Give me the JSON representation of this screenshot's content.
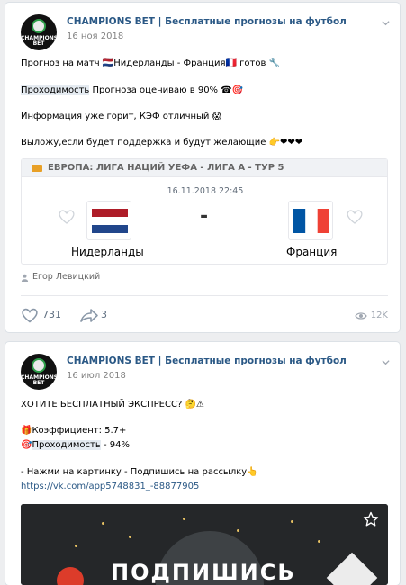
{
  "posts": [
    {
      "author": "CHAMPIONS BET | Бесплатные прогнозы на футбол",
      "avatar_text": "CHAMPIONS BET",
      "date": "16 ноя 2018",
      "lines": [
        {
          "pre": "Прогноз на матч ",
          "mid": "Нидерланды - Франция",
          "post": " готов"
        },
        {
          "hl": "Проходимость",
          "text": " Прогноза оцениваю в 90% "
        },
        {
          "text": "Информация уже горит, КЭФ отличный "
        },
        {
          "text": "Выложу,если будет поддержка и будут желающие "
        }
      ],
      "emojis": {
        "nl_flag": "🇳🇱",
        "fr_flag": "🇫🇷",
        "tools": "🔧",
        "phone": "☎🎯",
        "scream": "😱",
        "hearts": "👉❤❤❤"
      },
      "match_card": {
        "league": "ЕВРОПА: ЛИГА НАЦИЙ УЕФА - ЛИГА А - ТУР 5",
        "datetime": "16.11.2018 22:45",
        "separator": "-",
        "home": "Нидерланды",
        "away": "Франция"
      },
      "signer": "Егор Левицкий",
      "likes": "731",
      "shares": "3",
      "views": "12K"
    },
    {
      "author": "CHAMPIONS BET | Бесплатные прогнозы на футбол",
      "avatar_text": "CHAMPIONS BET",
      "date": "16 июл 2018",
      "lines": [
        {
          "text": "ХОТИТЕ БЕСПЛАТНЫЙ ЭКСПРЕСС? "
        },
        {
          "text": "Коэффициент: 5.7+"
        },
        {
          "hl": "Проходимость",
          "text": " - 94%"
        },
        {
          "text": "- Нажми на картинку - Подпишись на рассылку"
        },
        {
          "link": "https://vk.com/app5748831_-88877905"
        }
      ],
      "emojis": {
        "express": "🤔⚠",
        "gift": "🎁",
        "target": "🎯",
        "point": "👆"
      },
      "banner_text": "ПОДПИШИСЬ"
    }
  ],
  "colors": {
    "link": "#2a5885",
    "gray": "#828282",
    "bg": "#edeef0",
    "highlight": "#e5ebf1"
  }
}
